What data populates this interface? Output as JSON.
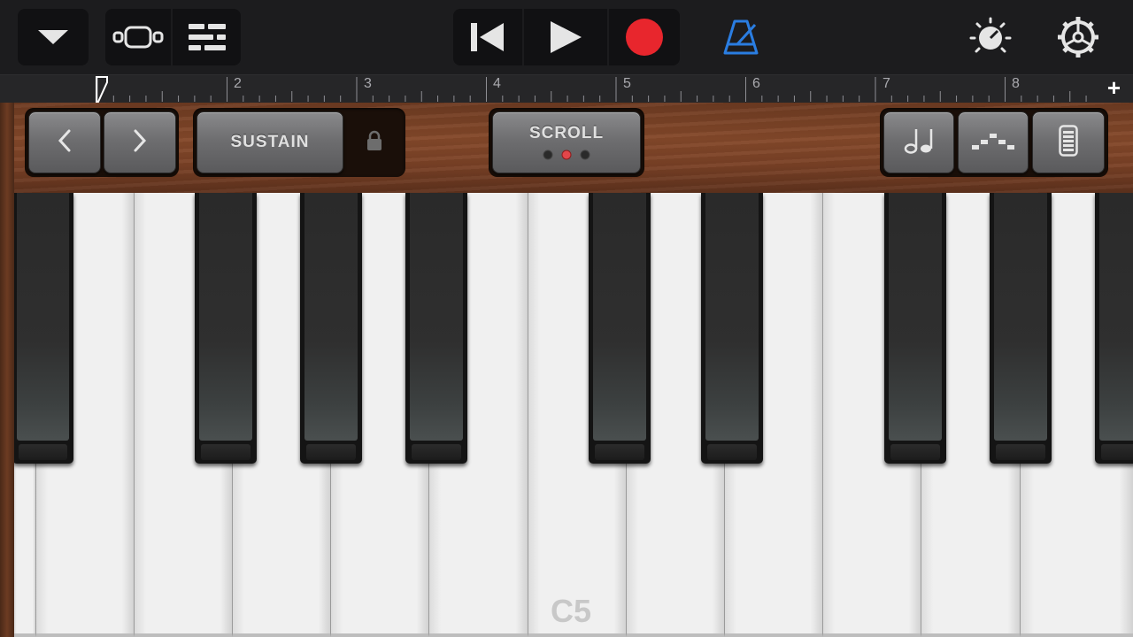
{
  "toolbar": {
    "colors": {
      "record": "#e8262d",
      "metronome": "#2a7de1",
      "icon": "#e5e5e5"
    },
    "icons": [
      "chevron-down-icon",
      "tracks-view-icon",
      "mixer-icon",
      "go-to-beginning-icon",
      "play-icon",
      "record-icon",
      "metronome-icon",
      "master-effects-icon",
      "settings-icon"
    ]
  },
  "ruler": {
    "bars": [
      "2",
      "3",
      "4",
      "5",
      "6",
      "7",
      "8"
    ],
    "add_label": "+"
  },
  "controls": {
    "octave_down": "‹",
    "octave_up": "›",
    "sustain_label": "SUSTAIN",
    "scroll_label": "SCROLL",
    "scroll_mode_active": 2
  },
  "keyboard": {
    "c_label": "C5",
    "white_keys": 12,
    "black_keys": 9
  }
}
